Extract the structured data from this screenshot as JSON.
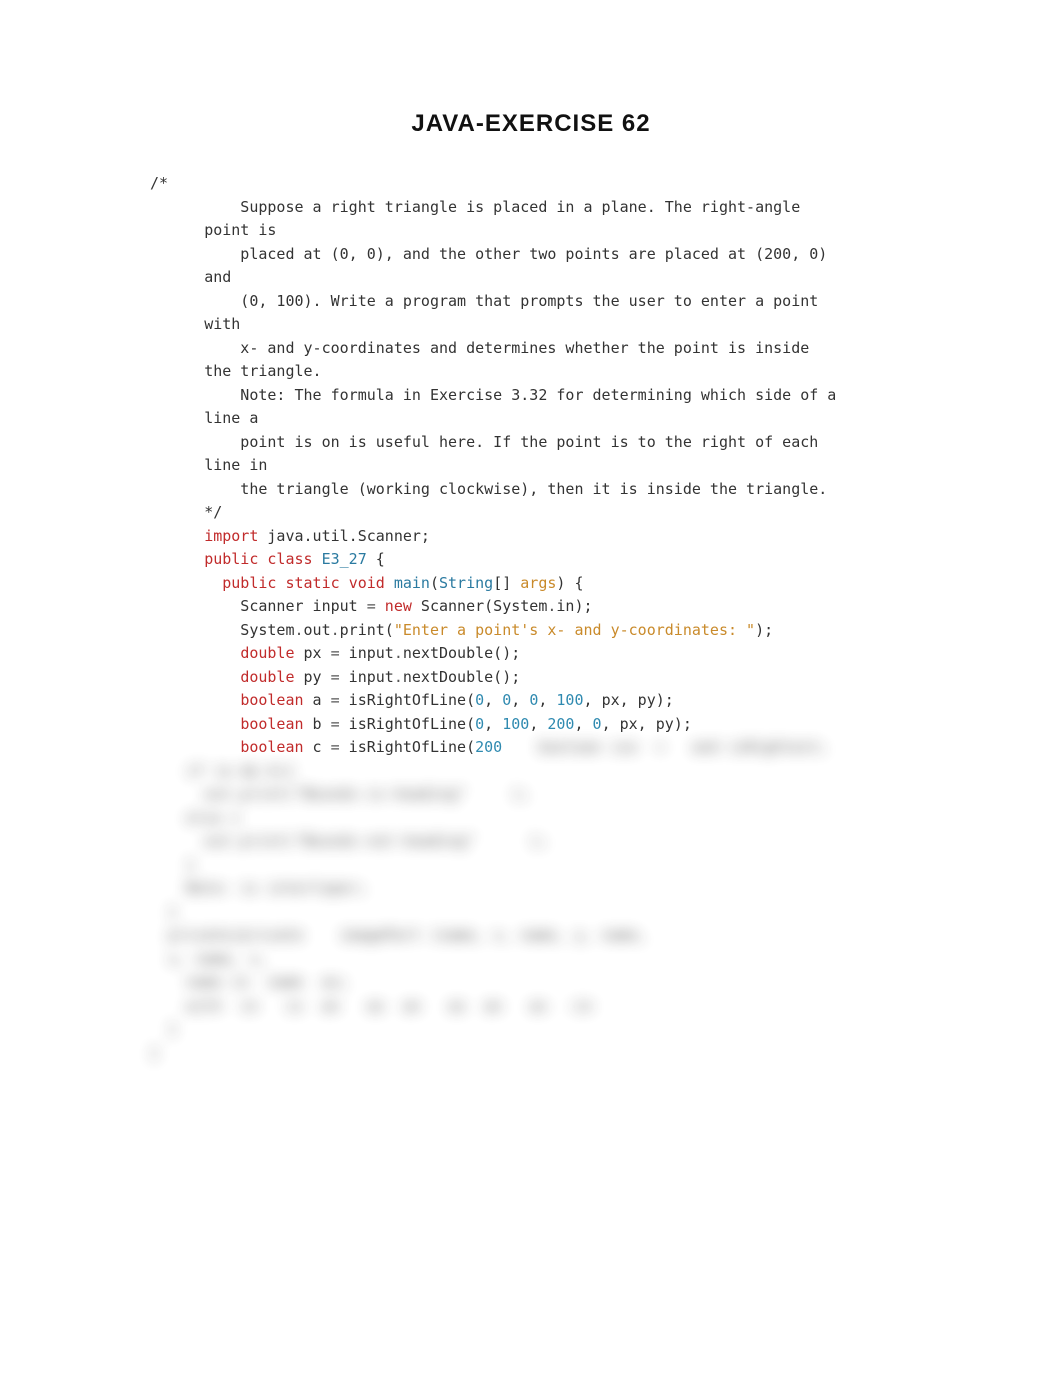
{
  "title": "JAVA-EXERCISE 62",
  "code": {
    "open_comment": "/*",
    "c1a": "  Suppose a right triangle is placed in a plane. The right-angle ",
    "c1b": "point is",
    "c2a": "  placed at (0, 0), and the other two points are placed at (200, 0) ",
    "c2b": "and",
    "c3a": "  (0, 100). Write a program that prompts the user to enter a point ",
    "c3b": "with",
    "c4a": "  x- and y-coordinates and determines whether the point is inside ",
    "c4b": "the triangle.",
    "c5": "  Note: The formula in Exercise 3.32 for determining which side of a ",
    "c5b": "line a",
    "c6a": "  point is on is useful here. If the point is to the right of each ",
    "c6b": "line in",
    "c7": "  the triangle (working clockwise), then it is inside the triangle.",
    "close_comment": "*/",
    "import_kw": "import",
    "import_rest": " java.util.Scanner;",
    "public_kw": "public",
    "class_kw": "class",
    "classname": "E3_27",
    "brace_open": " {",
    "static_kw": "static",
    "void_kw": "void",
    "main_name": "main",
    "lp": "(",
    "rp": ")",
    "string_type": "String",
    "brackets": "[]",
    "args_name": "args",
    "brace2": " {",
    "scanner_line_a": "    Scanner input ",
    "eq": "=",
    "new_kw": " new",
    "scanner_ctor": " Scanner(System",
    "dot": ".",
    "in_field": "in",
    "rpsc": ");",
    "sysout_a": "    System",
    "out_field": "out",
    "print_call": "print(",
    "prompt_str": "\"Enter a point's x- and y-coordinates: \"",
    "end_call": ");",
    "double_kw": "double",
    "px_decl": " px ",
    "py_decl": " py ",
    "input_next": " input",
    "nextDouble": "nextDouble();",
    "boolean_kw": "boolean",
    "a_decl": " a ",
    "b_decl": " b ",
    "c_decl": " c ",
    "isRight": " isRightOfLine(",
    "n0": "0",
    "n100": "100",
    "n200": "200",
    "comma": ", ",
    "pxpy": "px, py);",
    "blur_block": "    boolean iso  =   and isRightest;\n    if (a && b){\n      out.print(\"Bounds-is-heading\"     );\n    else {\n      out.print(\"Bounds-not-heading\"      );\n    }\n    Note: is interloper;\n  }\n  private/private    imagePart (name, x, name, y, name,\n  x, name, s,\n    name in  name  as;\n    with  in   is  an   as  an   as  an   as  -in\n  }\n}"
  }
}
